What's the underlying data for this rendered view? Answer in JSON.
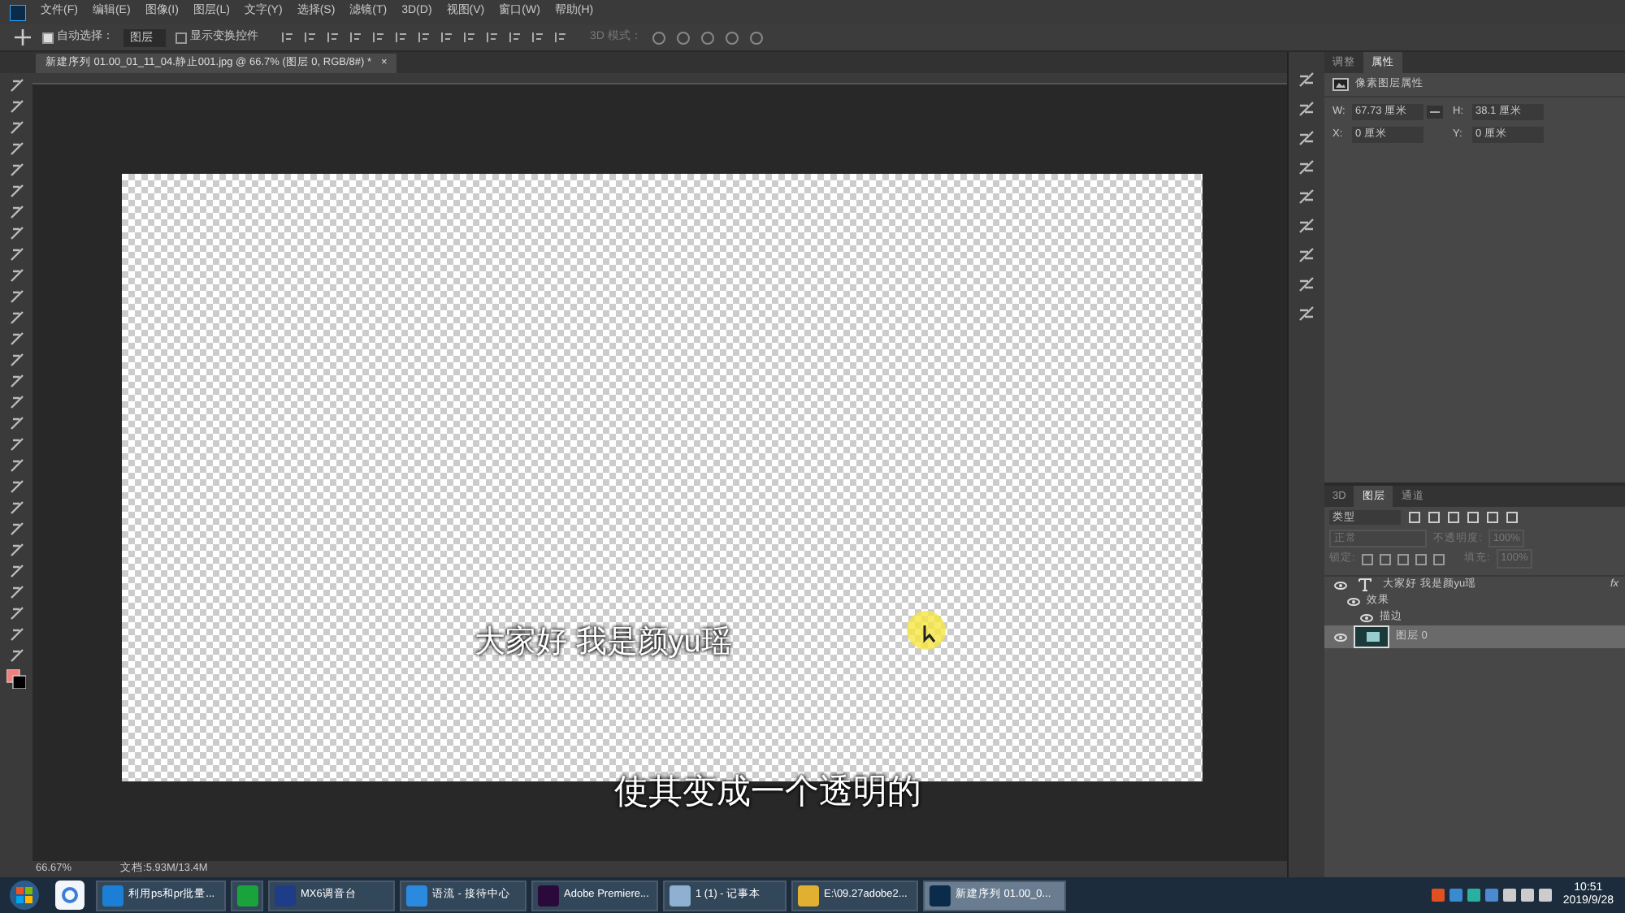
{
  "menu": [
    "文件(F)",
    "编辑(E)",
    "图像(I)",
    "图层(L)",
    "文字(Y)",
    "选择(S)",
    "滤镜(T)",
    "3D(D)",
    "视图(V)",
    "窗口(W)",
    "帮助(H)"
  ],
  "options_bar": {
    "auto_select": {
      "label": "自动选择：",
      "checked": true
    },
    "auto_select_target": "图层",
    "show_transform": {
      "label": "显示变换控件",
      "checked": false
    },
    "mode_3d": "3D 模式："
  },
  "document_tab": {
    "title": "新建序列 01.00_01_11_04.静止001.jpg @ 66.7% (图层 0, RGB/8#) *",
    "close": "×"
  },
  "canvas": {
    "subtitles": [
      "大家好  我是颜yu瑶",
      "使其变成一个透明的"
    ]
  },
  "properties_panel": {
    "tabs": [
      {
        "label": "调整",
        "selected": false
      },
      {
        "label": "属性",
        "selected": true
      }
    ],
    "heading": "像素图层属性",
    "fields": [
      {
        "label": "W:",
        "value": "67.73 厘米"
      },
      {
        "label": "H:",
        "value": "38.1 厘米"
      },
      {
        "label": "X:",
        "value": "0 厘米"
      },
      {
        "label": "Y:",
        "value": "0 厘米"
      }
    ]
  },
  "layers_panel": {
    "tabs": [
      {
        "label": "3D",
        "selected": false
      },
      {
        "label": "图层",
        "selected": true
      },
      {
        "label": "通道",
        "selected": false
      }
    ],
    "filter": "类型",
    "blend_mode": "正常",
    "opacity_label": "不透明度:",
    "opacity": "100%",
    "lock_label": "锁定:",
    "fill_label": "填充:",
    "fill": "100%",
    "layers": [
      {
        "kind": "text",
        "name": "大家好  我是颜yu瑶",
        "selected": false,
        "fx": "fx",
        "children": [
          {
            "name": "效果",
            "children": [
              {
                "name": "描边"
              }
            ]
          }
        ]
      },
      {
        "kind": "pixel",
        "name": "图层 0",
        "selected": true
      }
    ]
  },
  "status_bar": {
    "zoom": "66.67%",
    "doc": "文档:5.93M/13.4M"
  },
  "taskbar": {
    "items": [
      {
        "label": "利用ps和pr批量...",
        "selected": false
      },
      {
        "selected": false
      },
      {
        "label": "MX6调音台",
        "selected": false
      },
      {
        "label": "语流 - 接待中心",
        "selected": false
      },
      {
        "label": "Adobe Premiere...",
        "selected": false
      },
      {
        "label": "1 (1) - 记事本",
        "selected": false
      },
      {
        "label": "E:\\09.27adobe2...",
        "selected": false
      },
      {
        "label": "新建序列 01.00_0...",
        "selected": true
      }
    ],
    "time": "10:51",
    "date": "2019/9/28"
  }
}
